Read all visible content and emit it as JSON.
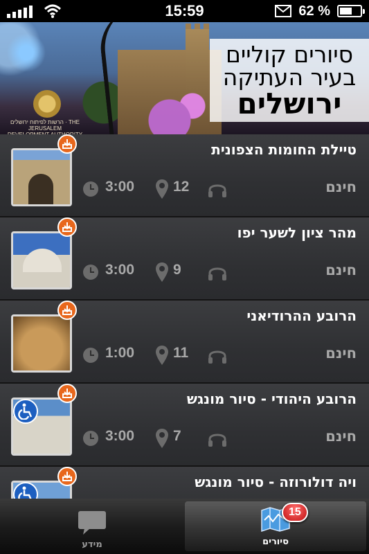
{
  "status_bar": {
    "time": "15:59",
    "battery_text": "62 %",
    "battery_level": 0.62
  },
  "banner": {
    "title_line1": "סיורים קוליים",
    "title_line2": "בעיר העתיקה",
    "title_line3": "ירושלים",
    "logo_caption": "הרשות לפיתוח ירושלים · THE JERUSALEM DEVELOPMENT AUTHORITY"
  },
  "tours": [
    {
      "title": "טיילת החומות הצפונית",
      "duration": "3:00",
      "stops": "12",
      "price": "חינם",
      "accessible": false,
      "thumb": "walls"
    },
    {
      "title": "מהר ציון לשער יפו",
      "duration": "3:00",
      "stops": "9",
      "price": "חינם",
      "accessible": false,
      "thumb": "zion"
    },
    {
      "title": "הרובע ההרודיאני",
      "duration": "1:00",
      "stops": "11",
      "price": "חינם",
      "accessible": false,
      "thumb": "herod"
    },
    {
      "title": "הרובע היהודי - סיור מונגש",
      "duration": "3:00",
      "stops": "7",
      "price": "חינם",
      "accessible": true,
      "thumb": "jewish"
    },
    {
      "title": "ויה דולורוזה - סיור מונגש",
      "duration": "",
      "stops": "",
      "price": "",
      "accessible": true,
      "thumb": "via"
    }
  ],
  "tabbar": {
    "info_label": "מידע",
    "tours_label": "סיורים",
    "tours_badge": "15"
  },
  "colors": {
    "badge_red": "#c20f0f",
    "download_orange": "#e8671c",
    "accessible_blue": "#1d5fc0"
  }
}
